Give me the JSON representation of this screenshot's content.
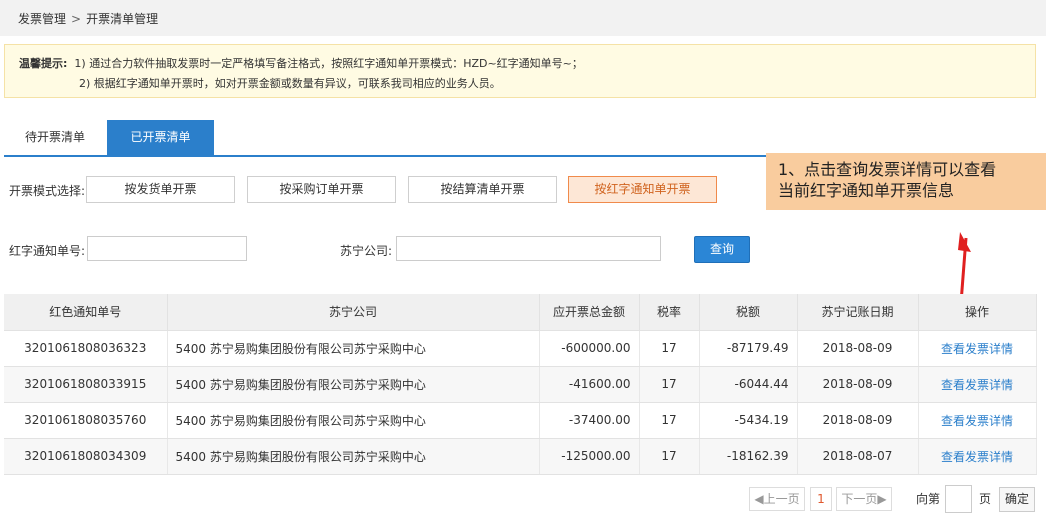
{
  "breadcrumb": {
    "root": "发票管理",
    "separator": ">",
    "current": "开票清单管理"
  },
  "notice": {
    "title": "温馨提示:",
    "line1": "1) 通过合力软件抽取发票时一定严格填写备注格式，按照红字通知单开票模式：HZD~红字通知单号~；",
    "line2": "2) 根据红字通知单开票时，如对开票金额或数量有异议，可联系我司相应的业务人员。"
  },
  "tabs": [
    {
      "label": "待开票清单",
      "active": false
    },
    {
      "label": "已开票清单",
      "active": true
    }
  ],
  "mode": {
    "label": "开票模式选择:",
    "options": [
      {
        "label": "按发货单开票",
        "active": false
      },
      {
        "label": "按采购订单开票",
        "active": false
      },
      {
        "label": "按结算清单开票",
        "active": false
      },
      {
        "label": "按红字通知单开票",
        "active": true
      }
    ]
  },
  "callout": {
    "line1": "1、点击查询发票详情可以查看",
    "line2": "当前红字通知单开票信息"
  },
  "search": {
    "notice_no_label": "红字通知单号:",
    "notice_no_value": "",
    "company_label": "苏宁公司:",
    "company_value": "",
    "query_label": "查询"
  },
  "table": {
    "columns": [
      "红色通知单号",
      "苏宁公司",
      "应开票总金额",
      "税率",
      "税额",
      "苏宁记账日期",
      "操作"
    ],
    "rows": [
      {
        "no": "3201061808036323",
        "company": "5400 苏宁易购集团股份有限公司苏宁采购中心",
        "amount": "-600000.00",
        "rate": "17",
        "tax": "-87179.49",
        "date": "2018-08-09",
        "action": "查看发票详情"
      },
      {
        "no": "3201061808033915",
        "company": "5400 苏宁易购集团股份有限公司苏宁采购中心",
        "amount": "-41600.00",
        "rate": "17",
        "tax": "-6044.44",
        "date": "2018-08-09",
        "action": "查看发票详情"
      },
      {
        "no": "3201061808035760",
        "company": "5400 苏宁易购集团股份有限公司苏宁采购中心",
        "amount": "-37400.00",
        "rate": "17",
        "tax": "-5434.19",
        "date": "2018-08-09",
        "action": "查看发票详情"
      },
      {
        "no": "3201061808034309",
        "company": "5400 苏宁易购集团股份有限公司苏宁采购中心",
        "amount": "-125000.00",
        "rate": "17",
        "tax": "-18162.39",
        "date": "2018-08-07",
        "action": "查看发票详情"
      }
    ]
  },
  "pager": {
    "prev_label": "◀上一页",
    "current_page": "1",
    "next_label": "下一页▶",
    "goto_prefix": "向第",
    "goto_value": "",
    "goto_suffix": "页",
    "confirm_label": "确定"
  },
  "colors": {
    "accent": "#2b7fcb",
    "callout": "#f9cc9e",
    "active_mode": "#f08a4b",
    "arrow": "#e02020"
  },
  "icons": {
    "arrow": "red-arrow-icon"
  }
}
